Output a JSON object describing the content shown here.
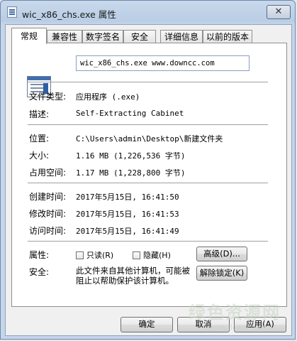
{
  "window": {
    "title": "wic_x86_chs.exe 属性",
    "close_label": "✕"
  },
  "tabs": [
    {
      "label": "常规",
      "active": true
    },
    {
      "label": "兼容性"
    },
    {
      "label": "数字签名"
    },
    {
      "label": "安全"
    },
    {
      "label": "详细信息"
    },
    {
      "label": "以前的版本"
    }
  ],
  "general": {
    "file_name": "wic_x86_chs.exe www.downcc.com",
    "type_label": "文件类型:",
    "type_value": "应用程序 (.exe)",
    "desc_label": "描述:",
    "desc_value": "Self-Extracting Cabinet",
    "location_label": "位置:",
    "location_value": "C:\\Users\\admin\\Desktop\\新建文件夹",
    "size_label": "大小:",
    "size_value": "1.16 MB (1,226,536 字节)",
    "disk_size_label": "占用空间:",
    "disk_size_value": "1.17 MB (1,228,800 字节)",
    "created_label": "创建时间:",
    "created_value": "2017年5月15日, 16:41:50",
    "modified_label": "修改时间:",
    "modified_value": "2017年5月15日, 16:41:53",
    "accessed_label": "访问时间:",
    "accessed_value": "2017年5月15日, 16:41:49",
    "attributes_label": "属性:",
    "readonly_label": "只读(R)",
    "hidden_label": "隐藏(H)",
    "advanced_button": "高级(D)...",
    "security_label": "安全:",
    "security_text": "此文件来自其他计算机，可能被阻止以帮助保护该计算机。",
    "unblock_button": "解除锁定(K)"
  },
  "footer": {
    "ok_button": "确定",
    "cancel_button": "取消",
    "apply_button": "应用(A)"
  },
  "watermark": {
    "text": "绿色资源网",
    "url": "www.downcc.com"
  }
}
